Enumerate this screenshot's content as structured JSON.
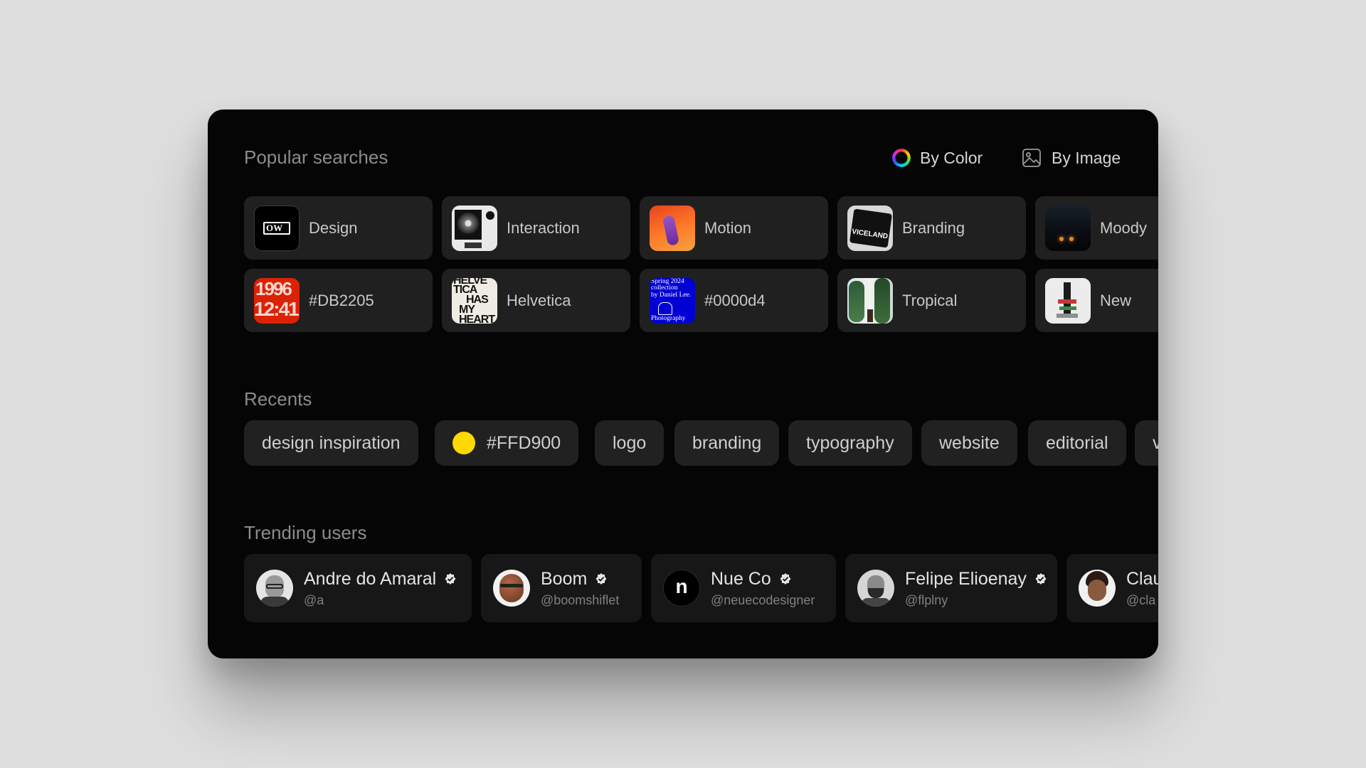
{
  "popular": {
    "title": "Popular searches",
    "by_color": "By Color",
    "by_image": "By Image",
    "tiles": [
      {
        "label": "Design",
        "thumb": "ow-logo"
      },
      {
        "label": "Interaction",
        "thumb": "dandelion-poster"
      },
      {
        "label": "Motion",
        "thumb": "hand-gradient"
      },
      {
        "label": "Branding",
        "thumb": "viceland-card"
      },
      {
        "label": "Moody",
        "thumb": "dark-room"
      },
      {
        "label": "#DB2205",
        "thumb": "red-numbers"
      },
      {
        "label": "Helvetica",
        "thumb": "helvetica-poster"
      },
      {
        "label": "#0000d4",
        "thumb": "blue-poster"
      },
      {
        "label": "Tropical",
        "thumb": "palm-trees"
      },
      {
        "label": "New",
        "thumb": "collage"
      }
    ],
    "thumb_text": {
      "design": "OW",
      "viceland": "VICELAND",
      "red_numbers_top": "1996",
      "red_numbers_bottom": "12:41",
      "helvetica": [
        "HELVE",
        "TICA",
        "HAS",
        "MY",
        "HEART"
      ],
      "blue_poster": [
        "Spring 2024",
        "collection",
        "by Daniel Lee.",
        "Photography"
      ]
    }
  },
  "recents": {
    "title": "Recents",
    "chips": [
      "design inspiration",
      "#FFD900",
      "logo",
      "branding",
      "typography",
      "website",
      "editorial",
      "v"
    ],
    "color_chip_swatch": "#FFD900"
  },
  "trending": {
    "title": "Trending users",
    "users": [
      {
        "name": "Andre do Amaral",
        "handle": "@a",
        "avatar": "portrait-glasses"
      },
      {
        "name": "Boom",
        "handle": "@boomshiflet",
        "avatar": "3d-avatar"
      },
      {
        "name": "Nue Co",
        "handle": "@neuecodesigner",
        "avatar": "nue-co-logo",
        "logo_letter": "n"
      },
      {
        "name": "Felipe Elioenay",
        "handle": "@flplny",
        "avatar": "portrait-beard"
      },
      {
        "name": "Clau",
        "handle": "@cla",
        "avatar": "memoji-woman"
      }
    ]
  },
  "colors": {
    "panel": "#050505",
    "tile": "#202020",
    "chip": "#212121",
    "accent_yellow": "#FFD900"
  }
}
